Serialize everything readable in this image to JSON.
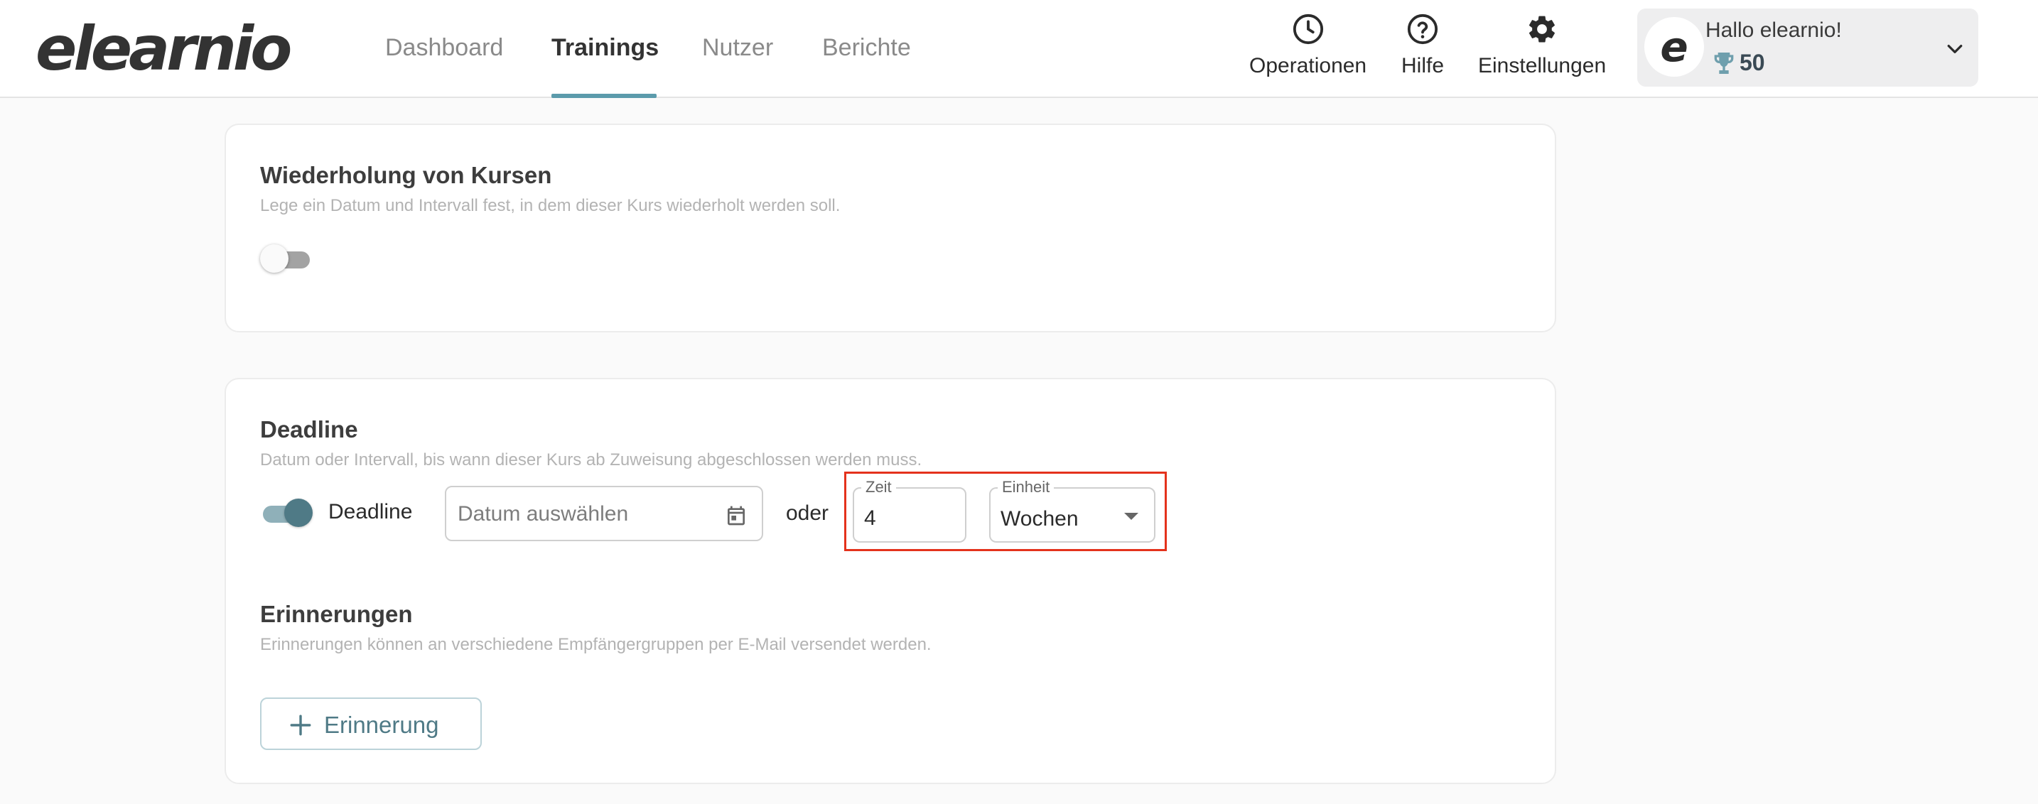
{
  "app": {
    "logo_text": "elearnio"
  },
  "nav": {
    "tabs": [
      {
        "label": "Dashboard"
      },
      {
        "label": "Trainings"
      },
      {
        "label": "Nutzer"
      },
      {
        "label": "Berichte"
      }
    ],
    "active": "Trainings"
  },
  "header_actions": {
    "operations": {
      "label": "Operationen",
      "icon": "clock-icon"
    },
    "help": {
      "label": "Hilfe",
      "icon": "help-circle-icon"
    },
    "settings": {
      "label": "Einstellungen",
      "icon": "gear-icon"
    }
  },
  "user": {
    "avatar_letter": "e",
    "greeting": "Hallo elearnio!",
    "points": "50"
  },
  "repetition": {
    "title": "Wiederholung von Kursen",
    "description": "Lege ein Datum und Intervall fest, in dem dieser Kurs wiederholt werden soll.",
    "enabled": false
  },
  "deadline": {
    "title": "Deadline",
    "description": "Datum oder Intervall, bis wann dieser Kurs ab Zuweisung abgeschlossen werden muss.",
    "toggle_label": "Deadline",
    "enabled": true,
    "date_placeholder": "Datum auswählen",
    "or_label": "oder",
    "time": {
      "legend": "Zeit",
      "value": "4"
    },
    "unit": {
      "legend": "Einheit",
      "value": "Wochen"
    }
  },
  "reminders": {
    "title": "Erinnerungen",
    "description": "Erinnerungen können an verschiedene Empfängergruppen per E-Mail versendet werden.",
    "add_label": "Erinnerung"
  },
  "colors": {
    "accent": "#4f7a86",
    "nav_underline": "#5b9bab",
    "highlight": "#e4321c"
  }
}
